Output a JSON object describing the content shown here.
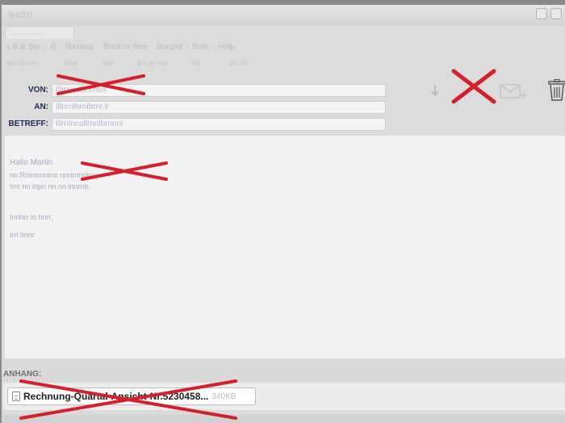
{
  "window": {
    "title": "Iindrrr",
    "tab_label": "—— ——"
  },
  "menu": [
    "s    B.B  Ber",
    "R",
    "Ilbrnsss",
    "Bnck nr  Bee",
    "Bnrpml",
    "Bnrk",
    "Help"
  ],
  "toolbar": [
    "Ibrrrnbrrrrr ·",
    "Bnrrr",
    "Mal",
    "Brr nn rnrrl",
    "Brr ·",
    "Brr  nrr"
  ],
  "header": {
    "from_label": "VON:",
    "from_value": "Illinnsdbnrnsls",
    "to_label": "AN:",
    "to_value": "Illnrnlbrnlbrnr.lr",
    "subject_label": "BETREFF:",
    "subject_value": "Illrnlnnsllrnnlbrnnnl"
  },
  "icons": {
    "download": "download-arrow-icon",
    "redacted": "red-x-mark",
    "forward": "forward-mail-icon",
    "trash": "trash-icon"
  },
  "body": {
    "lines": [
      "Hallo Martin",
      "nn Rnlrnrnnlrnr nnrlrnnnlnrnn",
      "hnr nn lnpn nn nn lnnrnlr.",
      "Inrlnrr in hnrr,",
      "Irrl hnnr"
    ]
  },
  "attachments": {
    "label": "ANHANG:",
    "items": [
      {
        "name": "Rechnung-Quartal-Ansicht-Nr.5230458...",
        "size": "340KB"
      }
    ]
  },
  "colors": {
    "label_blue": "#1e2a5a",
    "redaction_red": "#d4202a",
    "body_bg": "#f2f2f2"
  }
}
